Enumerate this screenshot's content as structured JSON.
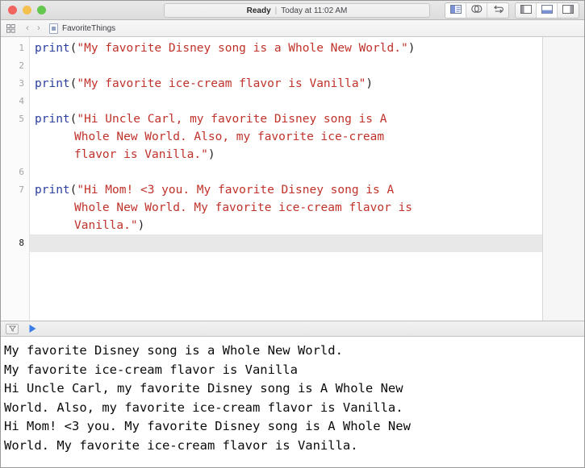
{
  "window": {
    "traffic_lights": [
      {
        "name": "close",
        "color": "#f2655f"
      },
      {
        "name": "minimize",
        "color": "#f4c04f"
      },
      {
        "name": "zoom",
        "color": "#64c850"
      }
    ],
    "status": {
      "state": "Ready",
      "separator": "|",
      "time": "Today at 11:02 AM"
    },
    "toolbar_right": [
      {
        "icon": "navigator-toggle-icon",
        "active": true
      },
      {
        "icon": "related-items-icon",
        "active": false
      },
      {
        "icon": "undo-redo-icon",
        "active": false
      },
      {
        "icon": "left-panel-icon",
        "active": false
      },
      {
        "icon": "bottom-panel-icon",
        "active": true
      },
      {
        "icon": "right-panel-icon",
        "active": false
      }
    ]
  },
  "breadcrumb": {
    "grid_icon": "grid-icon",
    "back_chevron": "‹",
    "forward_chevron": "›",
    "file_icon": "python-file-icon",
    "file_label": "FavoriteThings"
  },
  "editor": {
    "line_numbers": [
      "1",
      "2",
      "3",
      "4",
      "5",
      "",
      "",
      "6",
      "7",
      "",
      "",
      "8"
    ],
    "current_line": "8",
    "colors": {
      "keyword": "#2b3f9e",
      "string": "#c0322b",
      "punctuation": "#23232a",
      "active_line_bg": "#e8e8e8"
    },
    "lines": [
      {
        "number": "1",
        "kw": "print",
        "open": "(",
        "str": "\"My favorite Disney song is a Whole New World.\"",
        "close": ")"
      },
      {
        "number": "2",
        "kw": "",
        "open": "",
        "str": "",
        "close": ""
      },
      {
        "number": "3",
        "kw": "print",
        "open": "(",
        "str": "\"My favorite ice-cream flavor is Vanilla\"",
        "close": ")"
      },
      {
        "number": "4",
        "kw": "",
        "open": "",
        "str": "",
        "close": ""
      },
      {
        "number": "5",
        "kw": "print",
        "open": "(",
        "str": "\"Hi Uncle Carl, my favorite Disney song is A Whole New World. Also, my favorite ice-cream flavor is Vanilla.\"",
        "close": ")"
      },
      {
        "number": "6",
        "kw": "",
        "open": "",
        "str": "",
        "close": ""
      },
      {
        "number": "7",
        "kw": "print",
        "open": "(",
        "str": "\"Hi Mom! <3 you. My favorite Disney song is A Whole New World. My favorite ice-cream flavor is Vanilla.\"",
        "close": ")"
      },
      {
        "number": "8",
        "kw": "",
        "open": "",
        "str": "",
        "close": ""
      }
    ],
    "wrapped_rows": [
      {
        "num": "1",
        "kind": "code",
        "kw": "print",
        "open": "(",
        "str": "\"My favorite Disney song is a Whole New World.\"",
        "close": ")"
      },
      {
        "num": "2",
        "kind": "empty"
      },
      {
        "num": "3",
        "kind": "code",
        "kw": "print",
        "open": "(",
        "str": "\"My favorite ice-cream flavor is Vanilla\"",
        "close": ")"
      },
      {
        "num": "4",
        "kind": "empty"
      },
      {
        "num": "5",
        "kind": "code",
        "kw": "print",
        "open": "(",
        "str": "\"Hi Uncle Carl, my favorite Disney song is A",
        "close": ""
      },
      {
        "num": "",
        "kind": "cont",
        "str": "Whole New World. Also, my favorite ice-cream"
      },
      {
        "num": "",
        "kind": "cont",
        "str": "flavor is Vanilla.\"",
        "close": ")"
      },
      {
        "num": "6",
        "kind": "empty"
      },
      {
        "num": "7",
        "kind": "code",
        "kw": "print",
        "open": "(",
        "str": "\"Hi Mom! <3 you. My favorite Disney song is A",
        "close": ""
      },
      {
        "num": "",
        "kind": "cont",
        "str": "Whole New World. My favorite ice-cream flavor is"
      },
      {
        "num": "",
        "kind": "cont",
        "str": "Vanilla.\"",
        "close": ")"
      },
      {
        "num": "8",
        "kind": "active"
      }
    ]
  },
  "console": {
    "filter_icon": "filter-dropdown-icon",
    "play_icon": "play-icon",
    "output_lines": [
      "My favorite Disney song is a Whole New World.",
      "My favorite ice-cream flavor is Vanilla",
      "Hi Uncle Carl, my favorite Disney song is A Whole New",
      "World. Also, my favorite ice-cream flavor is Vanilla.",
      "Hi Mom! <3 you. My favorite Disney song is A Whole New",
      "World. My favorite ice-cream flavor is Vanilla."
    ]
  }
}
